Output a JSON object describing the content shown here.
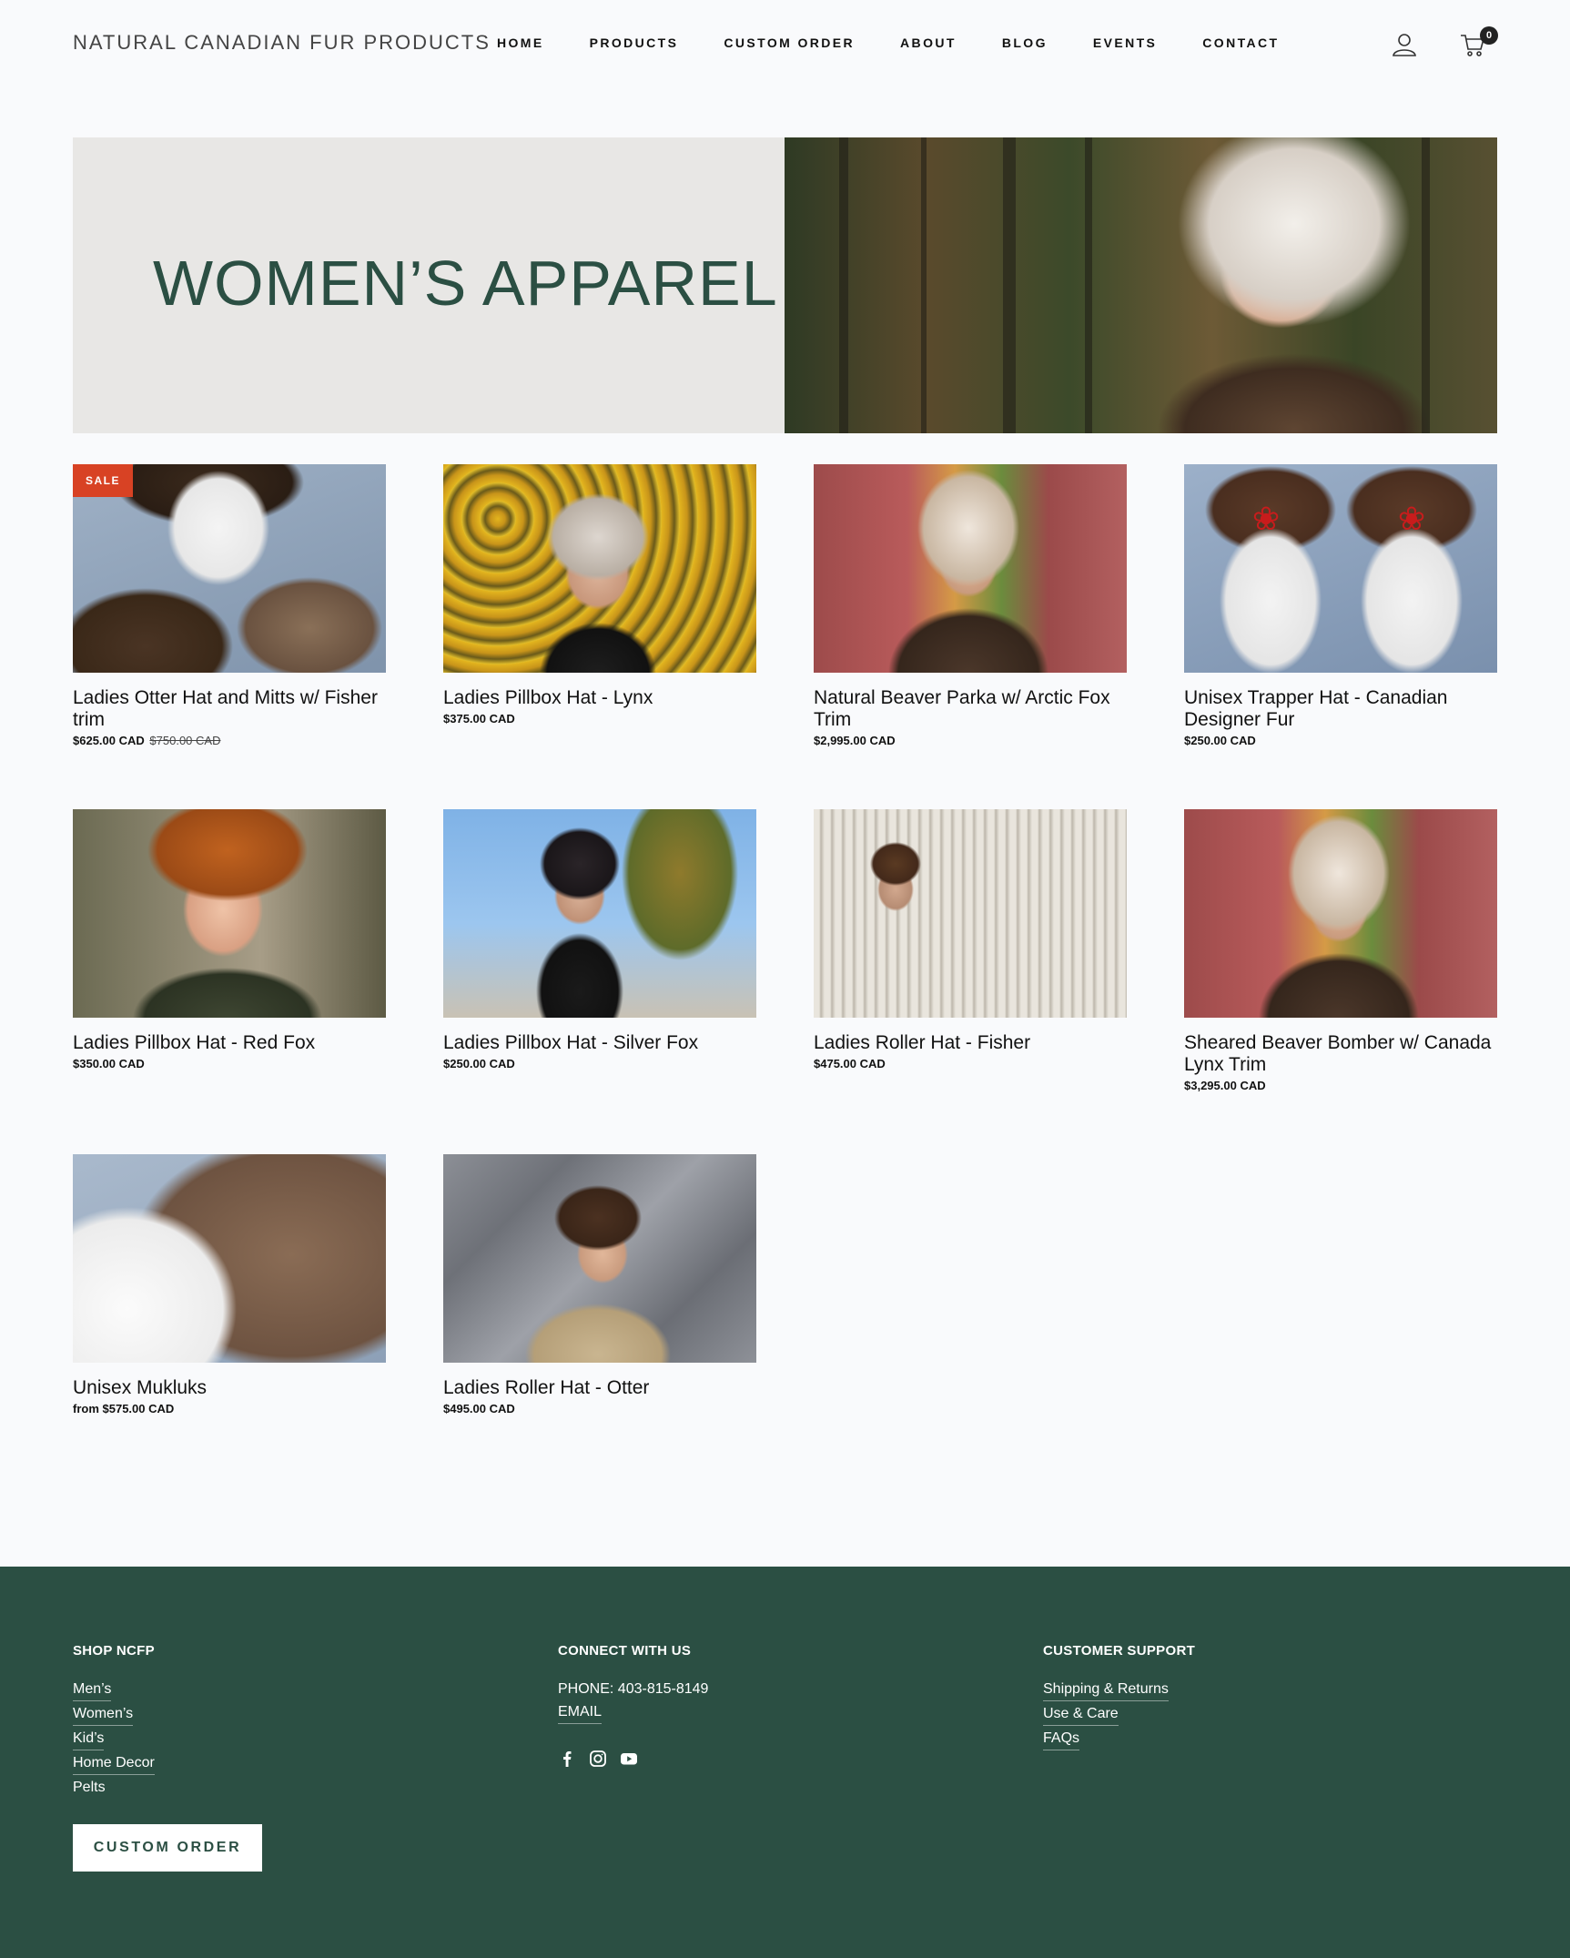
{
  "header": {
    "brand": "NATURAL CANADIAN FUR PRODUCTS",
    "nav": [
      "HOME",
      "PRODUCTS",
      "CUSTOM ORDER",
      "ABOUT",
      "BLOG",
      "EVENTS",
      "CONTACT"
    ],
    "cart_count": "0"
  },
  "hero": {
    "title": "WOMEN’S APPAREL"
  },
  "products": [
    {
      "name": "Ladies Otter Hat and Mitts w/ Fisher trim",
      "price": "$625.00 CAD",
      "was": "$750.00 CAD",
      "badge": "SALE"
    },
    {
      "name": "Ladies Pillbox Hat - Lynx",
      "price": "$375.00 CAD"
    },
    {
      "name": "Natural Beaver Parka w/ Arctic Fox Trim",
      "price": "$2,995.00 CAD"
    },
    {
      "name": "Unisex Trapper Hat - Canadian Designer Fur",
      "price": "$250.00 CAD"
    },
    {
      "name": "Ladies Pillbox Hat - Red Fox",
      "price": "$350.00 CAD"
    },
    {
      "name": "Ladies Pillbox Hat - Silver Fox",
      "price": "$250.00 CAD"
    },
    {
      "name": "Ladies Roller Hat - Fisher",
      "price": "$475.00 CAD"
    },
    {
      "name": "Sheared Beaver Bomber w/ Canada Lynx Trim",
      "price": "$3,295.00 CAD"
    },
    {
      "name": "Unisex Mukluks",
      "price": "from $575.00 CAD"
    },
    {
      "name": "Ladies Roller Hat - Otter",
      "price": "$495.00 CAD"
    }
  ],
  "footer": {
    "shop": {
      "heading": "SHOP NCFP",
      "links": [
        "Men’s",
        "Women’s",
        "Kid’s",
        "Home Decor",
        "Pelts"
      ]
    },
    "connect": {
      "heading": "CONNECT WITH US",
      "phone": "PHONE: 403-815-8149",
      "email": "EMAIL",
      "social_icons": [
        "facebook-icon",
        "instagram-icon",
        "youtube-icon"
      ]
    },
    "support": {
      "heading": "CUSTOMER SUPPORT",
      "links": [
        "Shipping & Returns",
        "Use & Care",
        "FAQs"
      ]
    },
    "cta_label": "CUSTOM ORDER"
  },
  "colors": {
    "brand_green": "#2b4f43",
    "sale_red": "#d84224",
    "hero_panel": "#e8e7e5"
  }
}
